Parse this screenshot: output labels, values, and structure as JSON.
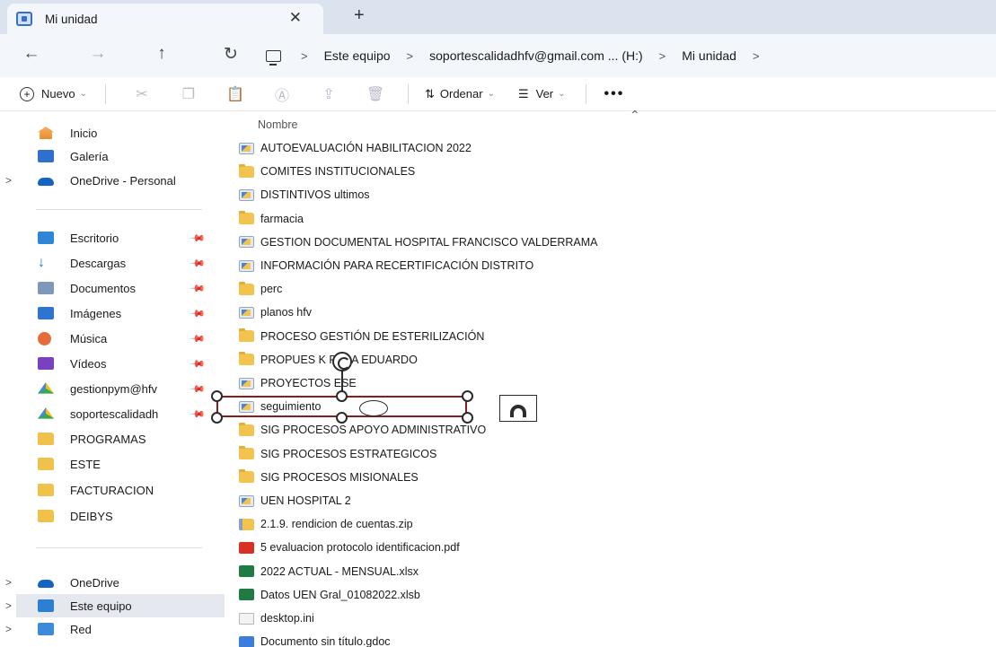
{
  "tab": {
    "title": "Mi unidad",
    "close": "✕",
    "new": "+"
  },
  "nav": {
    "back": "←",
    "forward": "→",
    "up": "↑",
    "refresh": "↻"
  },
  "breadcrumb": [
    "Este equipo",
    "soportescalidadhfv@gmail.com ... (H:)",
    "Mi unidad"
  ],
  "breadcrumb_sep": ">",
  "toolbar": {
    "new_label": "Nuevo",
    "sort_label": "Ordenar",
    "view_label": "Ver",
    "more_label": "•••"
  },
  "list_header": {
    "name_col": "Nombre"
  },
  "sidebar": {
    "quick": [
      {
        "label": "Inicio",
        "icon": "home-icon"
      },
      {
        "label": "Galería",
        "icon": "gallery-icon"
      },
      {
        "label": "OneDrive - Personal",
        "icon": "onedrive-icon",
        "expandable": true
      }
    ],
    "pinned": [
      {
        "label": "Escritorio",
        "icon": "desktop-icon"
      },
      {
        "label": "Descargas",
        "icon": "download-icon"
      },
      {
        "label": "Documentos",
        "icon": "documents-icon"
      },
      {
        "label": "Imágenes",
        "icon": "images-icon"
      },
      {
        "label": "Música",
        "icon": "music-icon"
      },
      {
        "label": "Vídeos",
        "icon": "videos-icon"
      },
      {
        "label": "gestionpym@hfv",
        "icon": "google-drive-icon"
      },
      {
        "label": "soportescalidadh",
        "icon": "google-drive-icon"
      },
      {
        "label": "PROGRAMAS",
        "icon": "folder-icon"
      },
      {
        "label": "ESTE",
        "icon": "folder-icon"
      },
      {
        "label": "FACTURACION",
        "icon": "folder-icon"
      },
      {
        "label": "DEIBYS",
        "icon": "folder-icon"
      }
    ],
    "devices": [
      {
        "label": "OneDrive",
        "icon": "onedrive-icon"
      },
      {
        "label": "Este equipo",
        "icon": "pc-icon",
        "selected": true
      },
      {
        "label": "Red",
        "icon": "network-icon"
      }
    ]
  },
  "files": [
    {
      "name": "AUTOEVALUACIÓN HABILITACION 2022",
      "type": "shortcut"
    },
    {
      "name": "COMITES INSTITUCIONALES",
      "type": "folder"
    },
    {
      "name": "DISTINTIVOS ultimos",
      "type": "shortcut"
    },
    {
      "name": "farmacia",
      "type": "folder"
    },
    {
      "name": "GESTION DOCUMENTAL HOSPITAL FRANCISCO VALDERRAMA",
      "type": "shortcut"
    },
    {
      "name": "INFORMACIÓN PARA RECERTIFICACIÓN DISTRITO",
      "type": "shortcut"
    },
    {
      "name": "perc",
      "type": "folder"
    },
    {
      "name": "planos hfv",
      "type": "shortcut"
    },
    {
      "name": "PROCESO GESTIÓN DE ESTERILIZACIÓN",
      "type": "folder"
    },
    {
      "name": "PROPUES   K PARA EDUARDO",
      "type": "folder"
    },
    {
      "name": "PROYECTOS ESE",
      "type": "shortcut"
    },
    {
      "name": "seguimiento",
      "type": "shortcut"
    },
    {
      "name": "SIG PROCESOS APOYO ADMINISTRATIVO",
      "type": "folder"
    },
    {
      "name": "SIG PROCESOS ESTRATEGICOS",
      "type": "folder"
    },
    {
      "name": "SIG PROCESOS MISIONALES",
      "type": "folder"
    },
    {
      "name": "UEN HOSPITAL 2",
      "type": "shortcut"
    },
    {
      "name": "2.1.9. rendicion de cuentas.zip",
      "type": "zip"
    },
    {
      "name": "5 evaluacion protocolo identificacion.pdf",
      "type": "pdf"
    },
    {
      "name": "2022 ACTUAL - MENSUAL.xlsx",
      "type": "xlsx"
    },
    {
      "name": "Datos UEN Gral_01082022.xlsb",
      "type": "xlsx"
    },
    {
      "name": "desktop.ini",
      "type": "ini"
    },
    {
      "name": "Documento sin título.gdoc",
      "type": "gdoc"
    }
  ],
  "colors": {
    "tabbar": "#dbe3ef",
    "selection_border": "#8b1c1c",
    "folder": "#f2c34e",
    "accent": "#2f6fce"
  }
}
